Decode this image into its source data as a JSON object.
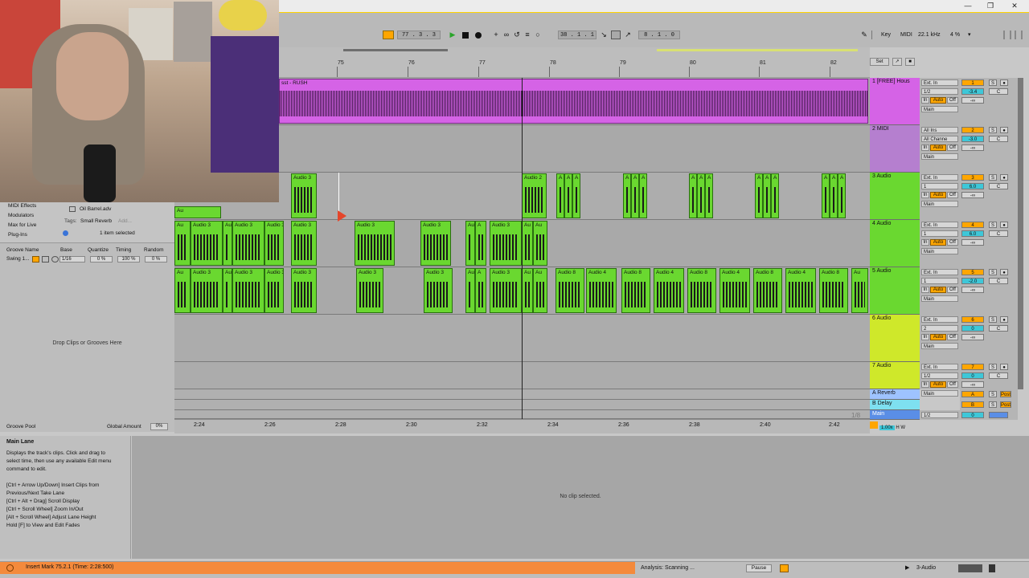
{
  "transport": {
    "position": "77 .  3 .  3",
    "loop_start": "38 .  1 .  1",
    "loop_length": "8 .  1 .  0",
    "key_label": "Key",
    "midi_label": "MIDI",
    "sample_rate": "22.1 kHz",
    "cpu": "4 %"
  },
  "ruler": {
    "bars": [
      "75",
      "76",
      "77",
      "78",
      "79",
      "80",
      "81",
      "82"
    ],
    "set_label": "Set"
  },
  "timescale": {
    "times": [
      "2:24",
      "2:26",
      "2:28",
      "2:30",
      "2:32",
      "2:34",
      "2:36",
      "2:38",
      "2:40",
      "2:42"
    ],
    "zoom_label": "1/8"
  },
  "tracks": [
    {
      "num": "1",
      "name": "1 [FREE] Hous",
      "color": "#d563e6",
      "input": "Ext. In",
      "channel": "1/2",
      "monitor": [
        "In",
        "Auto",
        "Off"
      ],
      "output": "Main",
      "volume": "-3.4",
      "pan": "C",
      "send": "-∞"
    },
    {
      "num": "2",
      "name": "2 MIDI",
      "color": "#b57fcf",
      "input": "All Ins",
      "channel": "All Channe",
      "monitor": [
        "In",
        "Auto",
        "Off"
      ],
      "output": "Main",
      "volume": "-3.0",
      "pan": "C",
      "send": "-∞"
    },
    {
      "num": "3",
      "name": "3 Audio",
      "color": "#6ad830",
      "input": "Ext. In",
      "channel": "1",
      "monitor": [
        "In",
        "Auto",
        "Off"
      ],
      "output": "Main",
      "volume": "6.0",
      "pan": "C",
      "send": "-∞"
    },
    {
      "num": "4",
      "name": "4 Audio",
      "color": "#6ad830",
      "input": "Ext. In",
      "channel": "1",
      "monitor": [
        "In",
        "Auto",
        "Off"
      ],
      "output": "Main",
      "volume": "6.0",
      "pan": "C",
      "send": "-∞"
    },
    {
      "num": "5",
      "name": "5 Audio",
      "color": "#6ad830",
      "input": "Ext. In",
      "channel": "1",
      "monitor": [
        "In",
        "Auto",
        "Off"
      ],
      "output": "Main",
      "volume": "-2.0",
      "pan": "C",
      "send": "-∞"
    },
    {
      "num": "6",
      "name": "6 Audio",
      "color": "#cfe82a",
      "input": "Ext. In",
      "channel": "2",
      "monitor": [
        "In",
        "Auto",
        "Off"
      ],
      "output": "Main",
      "volume": "0",
      "pan": "C",
      "send": "-∞"
    },
    {
      "num": "7",
      "name": "7 Audio",
      "color": "#cfe82a",
      "input": "Ext. In",
      "channel": "1/2",
      "monitor": [
        "In",
        "Auto",
        "Off"
      ],
      "output": "Main",
      "volume": "0",
      "pan": "C",
      "send": "-∞"
    }
  ],
  "returns": [
    {
      "letter": "A",
      "name": "A Reverb",
      "color": "#9ec3ff"
    },
    {
      "letter": "B",
      "name": "B Delay",
      "color": "#7ee0f0"
    }
  ],
  "master": {
    "name": "Main",
    "channel": "1/2",
    "volume": "0",
    "zoom": "1.00x"
  },
  "clips": {
    "track1_name": "sst - RUSH",
    "audio3": "Audio 3",
    "audio2": "Audio 2",
    "audio4": "Audio 4",
    "audio8": "Audio 8",
    "a": "A",
    "au": "Au"
  },
  "browser": {
    "items": [
      "MIDI Effects",
      "Modulators",
      "Max for Live",
      "Plug-Ins"
    ],
    "file": "Oil Barrel.adv",
    "tags_label": "Tags:",
    "tags_value": "Small Reverb",
    "tags_add": "Add...",
    "selected": "1 item selected"
  },
  "groove": {
    "headers": [
      "Groove Name",
      "Base",
      "Quantize",
      "Timing",
      "Random"
    ],
    "row": {
      "name": "Swing 1...",
      "base": "1/16",
      "quantize": "0 %",
      "timing": "100 %",
      "random": "0 %"
    },
    "drop_text": "Drop Clips or Grooves Here",
    "pool_label": "Groove Pool",
    "global_label": "Global Amount",
    "global_value": "0%"
  },
  "info": {
    "title": "Main Lane",
    "lines": [
      "Displays the track's clips. Click and drag to",
      "select time, then use any available Edit menu",
      "command to edit.",
      "",
      "[Ctrl + Arrow Up/Down] Insert Clips from",
      "Previous/Next Take Lane",
      "[Ctrl + Alt + Drag] Scroll Display",
      "[Ctrl + Scroll Wheel] Zoom In/Out",
      "[Alt + Scroll Wheel] Adjust Lane Height",
      "Hold [F] to View and Edit Fades"
    ]
  },
  "detail": {
    "empty": "No clip selected."
  },
  "status": {
    "message": "Insert Mark 75.2.1 (Time: 2:28:500)",
    "analysis": "Analysis: Scanning ...",
    "pause": "Pause",
    "track": "3-Audio"
  },
  "colors": {
    "accent": "#ffa600",
    "status_orange": "#f48a3c",
    "clip_green": "#6ad830",
    "clip_purple": "#d563e6"
  }
}
